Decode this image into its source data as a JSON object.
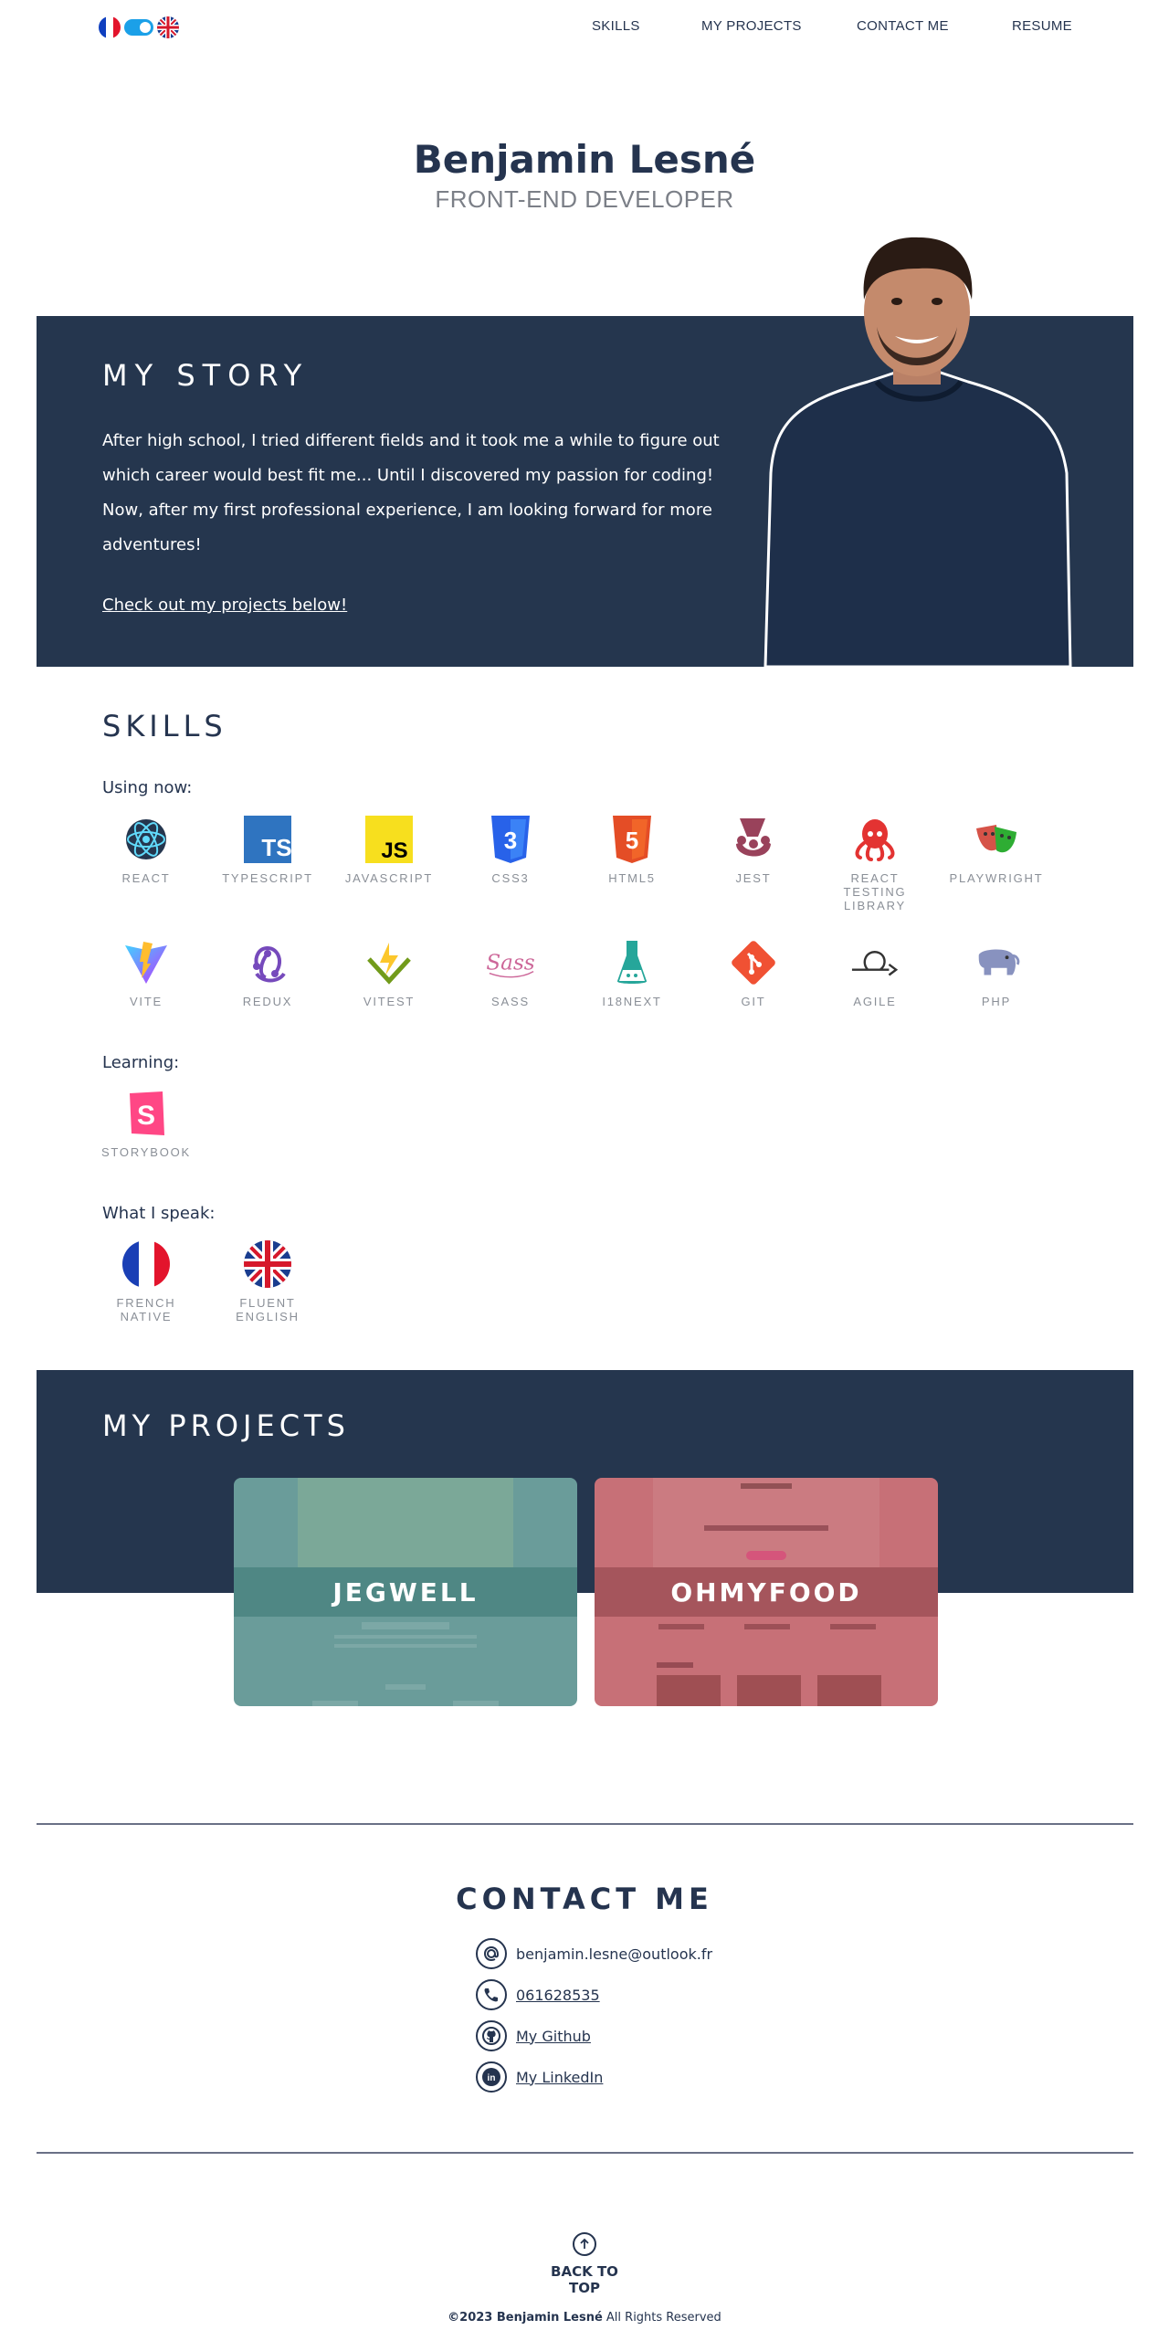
{
  "nav": {
    "flag_fr": "french-flag-icon",
    "flag_uk": "uk-flag-icon",
    "items": [
      "SKILLS",
      "MY PROJECTS",
      "CONTACT ME",
      "RESUME"
    ]
  },
  "hero": {
    "name": "Benjamin Lesné",
    "role": "FRONT-END DEVELOPER"
  },
  "story": {
    "title": "MY STORY",
    "text": "After high school, I tried different fields and it took me a while to figure out which career would best fit me... Until I discovered my passion for coding! Now, after my first professional experience, I am looking forward for more adventures!",
    "link": "Check out my projects below!"
  },
  "skills": {
    "title": "SKILLS",
    "using_label": "Using now:",
    "using": [
      {
        "label": "REACT",
        "icon": "react-icon"
      },
      {
        "label": "TYPESCRIPT",
        "icon": "typescript-icon"
      },
      {
        "label": "JAVASCRIPT",
        "icon": "javascript-icon"
      },
      {
        "label": "CSS3",
        "icon": "css3-icon"
      },
      {
        "label": "HTML5",
        "icon": "html5-icon"
      },
      {
        "label": "JEST",
        "icon": "jest-icon"
      },
      {
        "label": "REACT TESTING LIBRARY",
        "icon": "octopus-icon"
      },
      {
        "label": "PLAYWRIGHT",
        "icon": "playwright-icon"
      },
      {
        "label": "VITE",
        "icon": "vite-icon"
      },
      {
        "label": "REDUX",
        "icon": "redux-icon"
      },
      {
        "label": "VITEST",
        "icon": "vitest-icon"
      },
      {
        "label": "SASS",
        "icon": "sass-icon"
      },
      {
        "label": "I18NEXT",
        "icon": "i18next-icon"
      },
      {
        "label": "GIT",
        "icon": "git-icon"
      },
      {
        "label": "AGILE",
        "icon": "agile-icon"
      },
      {
        "label": "PHP",
        "icon": "php-icon"
      }
    ],
    "learning_label": "Learning:",
    "learning": [
      {
        "label": "STORYBOOK",
        "icon": "storybook-icon"
      }
    ],
    "speak_label": "What I speak:",
    "speak": [
      {
        "label": "FRENCH NATIVE",
        "icon": "french-flag-icon"
      },
      {
        "label": "FLUENT ENGLISH",
        "icon": "uk-flag-icon"
      }
    ]
  },
  "projects": {
    "title": "MY PROJECTS",
    "cards": [
      {
        "name": "JEGWELL",
        "color": "#5d9694"
      },
      {
        "name": "OHMYFOOD",
        "color": "#c45e66"
      }
    ]
  },
  "contact": {
    "title": "CONTACT ME",
    "email": "benjamin.lesne@outlook.fr",
    "phone": "061628535",
    "github": "My Github",
    "linkedin": "My LinkedIn"
  },
  "footer": {
    "back_to_top": "BACK TO TOP",
    "copyright_name": "©2023 Benjamin Lesné",
    "copyright_rest": " All Rights Reserved"
  }
}
